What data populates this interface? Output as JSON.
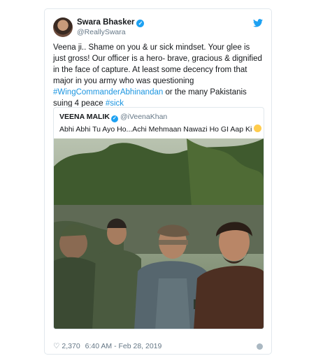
{
  "author": {
    "name": "Swara Bhasker",
    "handle": "@ReallySwara"
  },
  "tweet": {
    "text_parts": [
      "Veena ji.. Shame on you & ur sick mindset. Your glee is just gross! Our officer is a hero- brave, gracious & dignified in the face of capture. At least some decency from that major in you army who was questioning ",
      "#WingCommanderAbhinandan",
      " or the many Pakistanis suing 4 peace ",
      "#sick"
    ]
  },
  "quote": {
    "name": "VEENA MALIK",
    "handle": "@iVeenaKhan",
    "text": "Abhi Abhi Tu Ayo Ho...Achi Mehmaan Nawazi Ho GI Aap Ki"
  },
  "footer": {
    "likes": "2,370",
    "timestamp": "6:40 AM - Feb 28, 2019"
  },
  "colors": {
    "link": "#1b95e0",
    "verified": "#1da1f2",
    "muted": "#657786"
  }
}
